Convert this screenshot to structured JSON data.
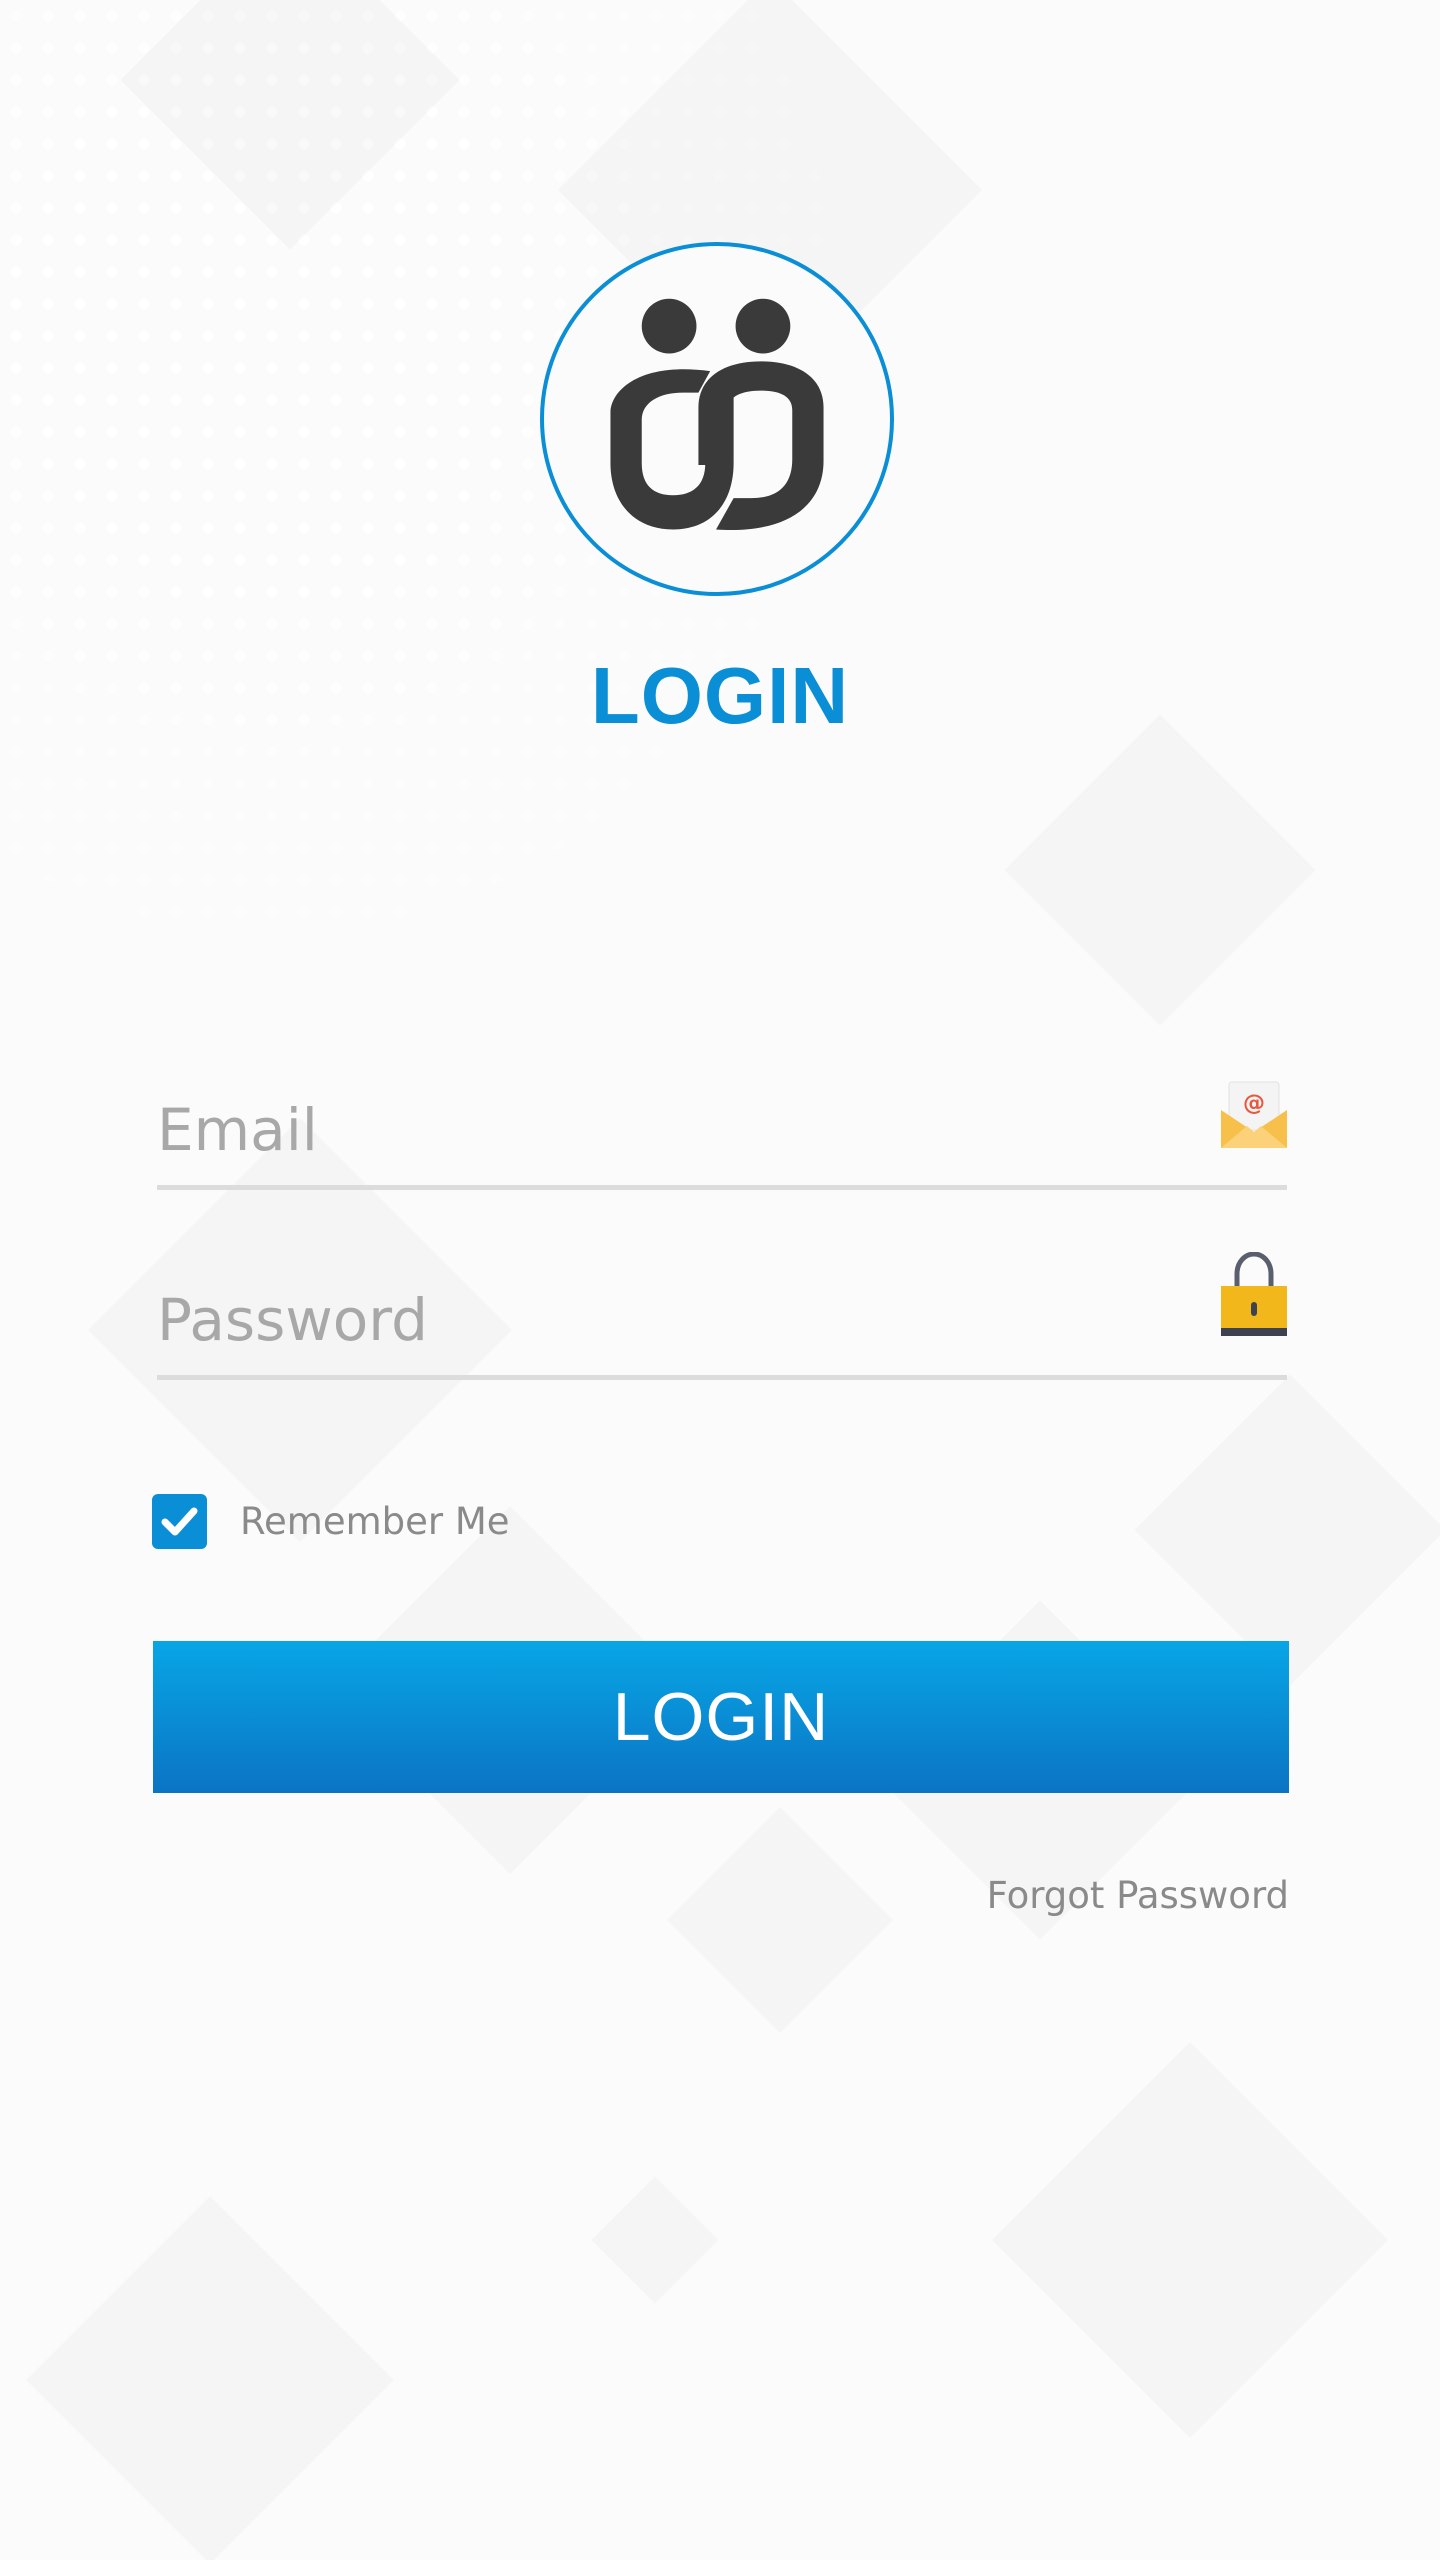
{
  "header": {
    "title": "LOGIN",
    "logo_icon": "two-people-logo-icon"
  },
  "form": {
    "email": {
      "placeholder": "Email",
      "value": "",
      "icon": "envelope-email-icon"
    },
    "password": {
      "placeholder": "Password",
      "value": "",
      "icon": "padlock-icon"
    },
    "remember_me": {
      "label": "Remember Me",
      "checked": true
    },
    "submit_label": "LOGIN",
    "forgot_password_label": "Forgot Password"
  },
  "colors": {
    "accent": "#0a8ed6",
    "button_top": "#08a6e6",
    "button_bottom": "#0b74c4",
    "placeholder": "#a8a8a8",
    "muted_text": "#8a8a8a",
    "underline": "#dcdcdc",
    "logo_dark": "#3a3a3a"
  }
}
